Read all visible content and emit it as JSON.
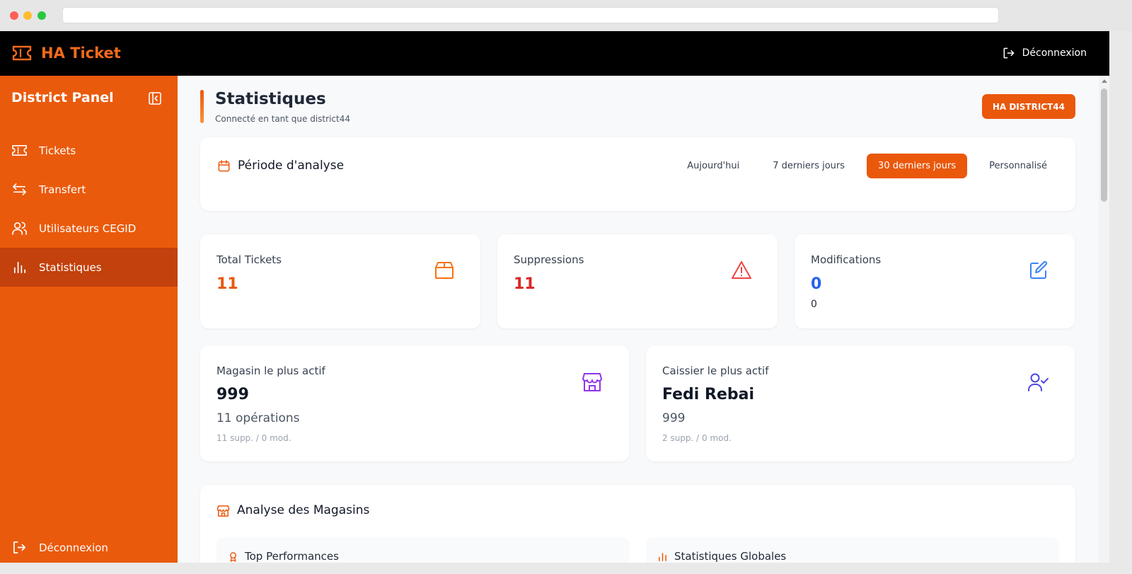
{
  "app": {
    "name": "HA Ticket",
    "logout_label": "Déconnexion",
    "colors": {
      "accent": "#ea580c",
      "header": "#000000",
      "sidebar": "#ea5a0c"
    }
  },
  "sidebar": {
    "title": "District Panel",
    "items": [
      {
        "label": "Tickets",
        "icon": "ticket-icon"
      },
      {
        "label": "Transfert",
        "icon": "arrows-left-right-icon"
      },
      {
        "label": "Utilisateurs CEGID",
        "icon": "users-icon"
      },
      {
        "label": "Statistiques",
        "icon": "bar-chart-icon",
        "active": true
      }
    ],
    "logout_label": "Déconnexion"
  },
  "page": {
    "title": "Statistiques",
    "subtitle": "Connecté en tant que district44",
    "badge": "HA DISTRICT44"
  },
  "period": {
    "title": "Période d'analyse",
    "options": [
      "Aujourd'hui",
      "7 derniers jours",
      "30 derniers jours",
      "Personnalisé"
    ],
    "selected": "30 derniers jours"
  },
  "stats": {
    "total": {
      "label": "Total Tickets",
      "value": "11",
      "color": "#ea580c"
    },
    "deletions": {
      "label": "Suppressions",
      "value": "11",
      "color": "#dc2626"
    },
    "modifications": {
      "label": "Modifications",
      "value": "0",
      "sub": "0",
      "color": "#2563eb"
    }
  },
  "highlights": {
    "store": {
      "label": "Magasin le plus actif",
      "value": "999",
      "sub": "11 opérations",
      "detail": "11 supp. / 0 mod."
    },
    "cashier": {
      "label": "Caissier le plus actif",
      "value": "Fedi Rebai",
      "sub": "999",
      "detail": "2 supp. / 0 mod."
    }
  },
  "analysis": {
    "title": "Analyse des Magasins",
    "top_title": "Top Performances",
    "global_title": "Statistiques Globales"
  }
}
